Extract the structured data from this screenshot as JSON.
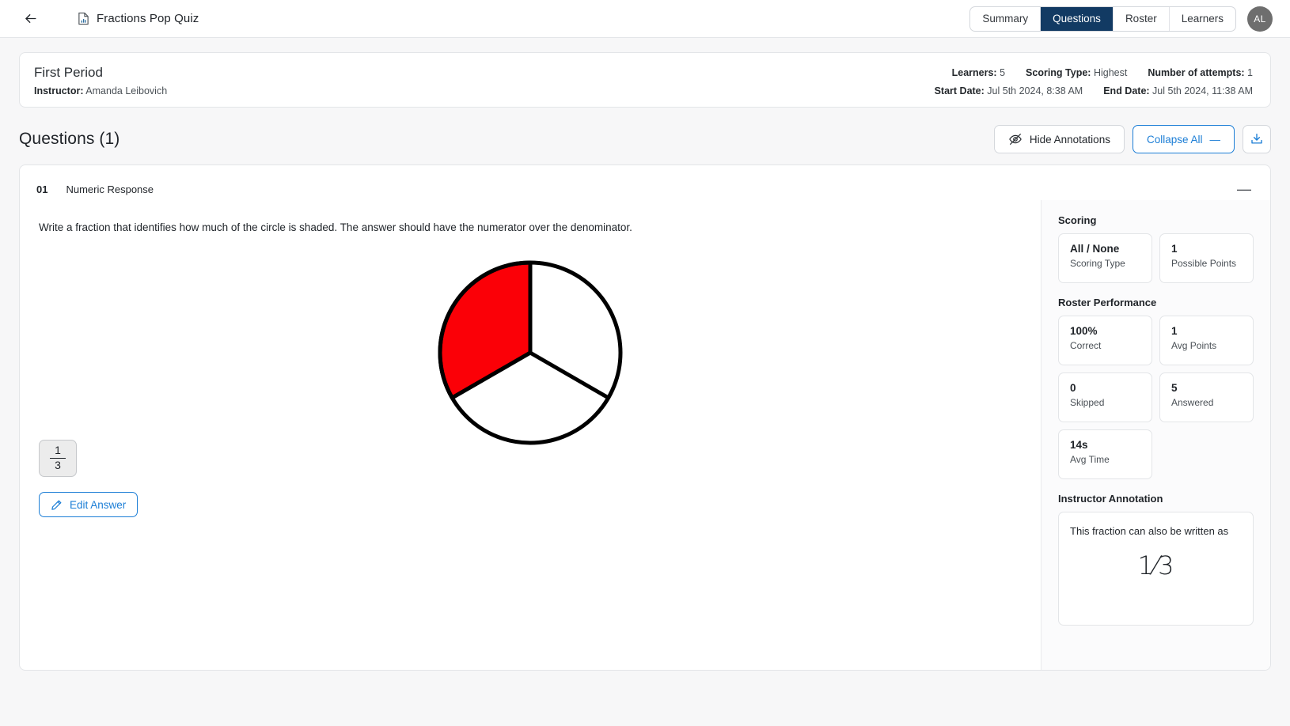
{
  "topbar": {
    "back_icon": "arrow-left-icon",
    "doc_icon": "document-chart-icon",
    "title": "Fractions Pop Quiz",
    "tabs": [
      {
        "label": "Summary",
        "active": false
      },
      {
        "label": "Questions",
        "active": true
      },
      {
        "label": "Roster",
        "active": false
      },
      {
        "label": "Learners",
        "active": false
      }
    ],
    "avatar_initials": "AL"
  },
  "info": {
    "period": "First Period",
    "instructor_label": "Instructor:",
    "instructor_name": "Amanda Leibovich",
    "learners_label": "Learners:",
    "learners_value": "5",
    "scoring_type_label": "Scoring Type:",
    "scoring_type_value": "Highest",
    "attempts_label": "Number of attempts:",
    "attempts_value": "1",
    "start_label": "Start Date:",
    "start_value": "Jul 5th 2024, 8:38 AM",
    "end_label": "End Date:",
    "end_value": "Jul 5th 2024, 11:38 AM"
  },
  "questions_header": {
    "title": "Questions (1)",
    "hide_annotations": "Hide Annotations",
    "collapse_all": "Collapse All",
    "collapse_all_glyph": "—",
    "download_icon": "download-icon"
  },
  "question": {
    "number": "01",
    "type": "Numeric Response",
    "collapse_glyph": "—",
    "prompt": "Write a fraction that identifies how much of the circle is shaded. The answer should have the numerator over the denominator.",
    "answer_numerator": "1",
    "answer_denominator": "3",
    "edit_answer": "Edit Answer"
  },
  "figure": {
    "type": "pie",
    "slices": 3,
    "shaded_slices": 1,
    "shaded_color": "#fb0007",
    "unshaded_color": "#ffffff",
    "stroke_color": "#000000"
  },
  "sidebar": {
    "scoring_title": "Scoring",
    "scoring_stats": [
      {
        "value": "All / None",
        "label": "Scoring Type"
      },
      {
        "value": "1",
        "label": "Possible Points"
      }
    ],
    "roster_title": "Roster Performance",
    "roster_stats": [
      {
        "value": "100%",
        "label": "Correct"
      },
      {
        "value": "1",
        "label": "Avg Points"
      },
      {
        "value": "0",
        "label": "Skipped"
      },
      {
        "value": "5",
        "label": "Answered"
      },
      {
        "value": "14s",
        "label": "Avg Time"
      }
    ],
    "annotation_title": "Instructor Annotation",
    "annotation_text": "This fraction can also be written as",
    "annotation_fraction": "1⁄3"
  },
  "colors": {
    "accent_blue": "#1c7ed6",
    "active_tab": "#123a63",
    "shaded_red": "#fb0007"
  }
}
